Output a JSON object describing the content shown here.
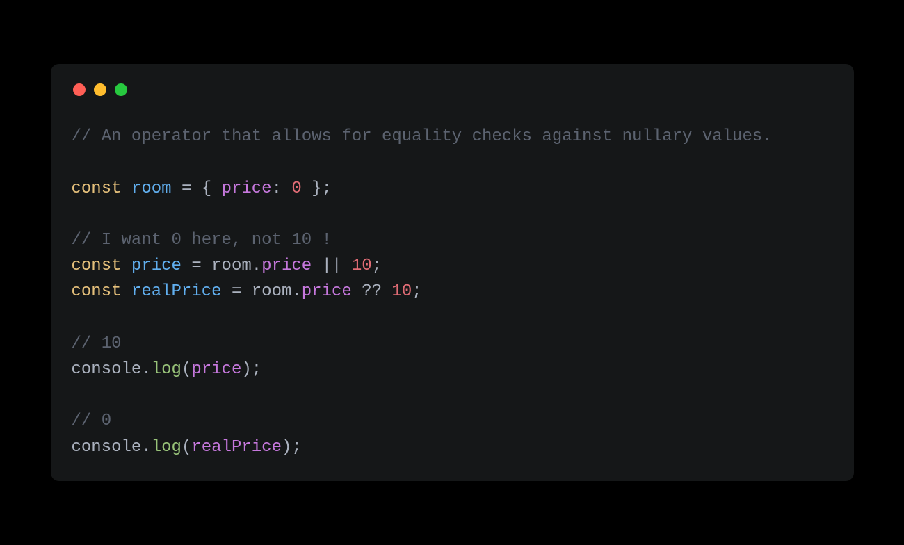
{
  "traffic_lights": {
    "red": "#ff5f56",
    "yellow": "#ffbd2e",
    "green": "#27c93f"
  },
  "code": {
    "l1": {
      "comment": "// An operator that allows for equality checks against nullary values."
    },
    "l2": "",
    "l3": {
      "keyword": "const",
      "sp1": " ",
      "var": "room",
      "sp2": " ",
      "eq": "=",
      "sp3": " ",
      "lb": "{",
      "sp4": " ",
      "prop": "price",
      "colon": ":",
      "sp5": " ",
      "num": "0",
      "sp6": " ",
      "rb": "}",
      "semi": ";"
    },
    "l4": "",
    "l5": {
      "comment": "// I want 0 here, not 10 !"
    },
    "l6": {
      "keyword": "const",
      "sp1": " ",
      "var": "price",
      "sp2": " ",
      "eq": "=",
      "sp3": " ",
      "obj": "room",
      "dot": ".",
      "prop": "price",
      "sp4": " ",
      "op": "||",
      "sp5": " ",
      "num": "10",
      "semi": ";"
    },
    "l7": {
      "keyword": "const",
      "sp1": " ",
      "var": "realPrice",
      "sp2": " ",
      "eq": "=",
      "sp3": " ",
      "obj": "room",
      "dot": ".",
      "prop": "price",
      "sp4": " ",
      "op": "??",
      "sp5": " ",
      "num": "10",
      "semi": ";"
    },
    "l8": "",
    "l9": {
      "comment": "// 10"
    },
    "l10": {
      "obj": "console",
      "dot": ".",
      "fn": "log",
      "lp": "(",
      "arg": "price",
      "rp": ")",
      "semi": ";"
    },
    "l11": "",
    "l12": {
      "comment": "// 0"
    },
    "l13": {
      "obj": "console",
      "dot": ".",
      "fn": "log",
      "lp": "(",
      "arg": "realPrice",
      "rp": ")",
      "semi": ";"
    }
  }
}
